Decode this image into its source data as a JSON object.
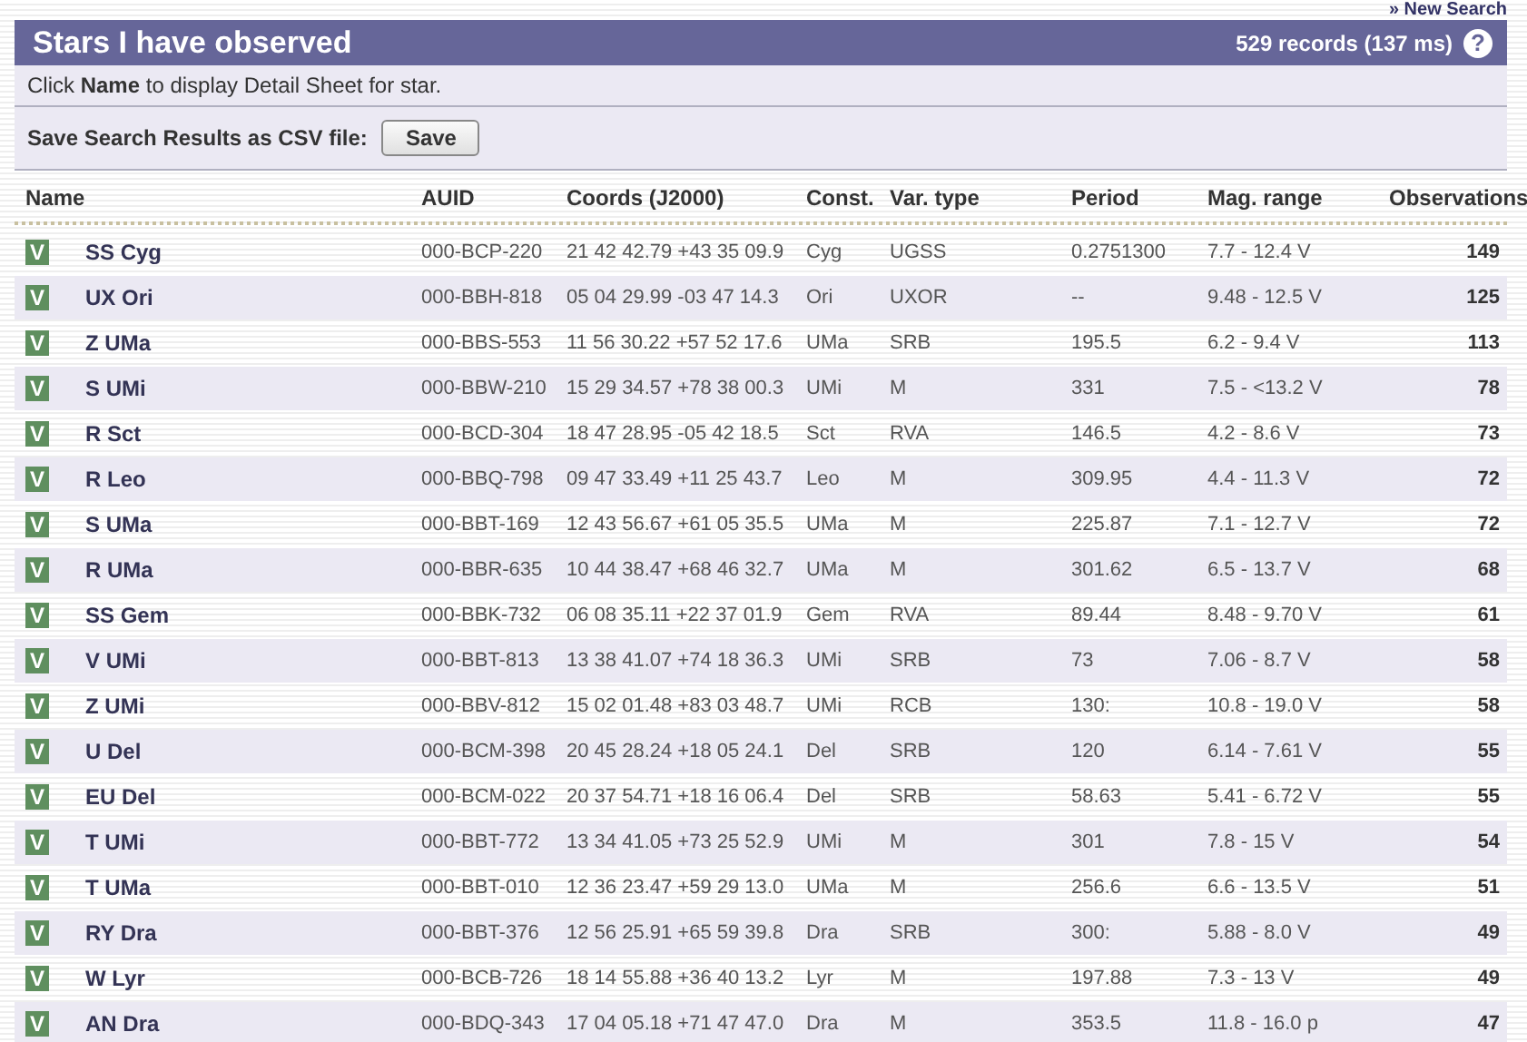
{
  "top_link": "» New Search",
  "header": {
    "title": "Stars I have observed",
    "records": "529 records (137 ms)",
    "help": "?"
  },
  "hint": {
    "before": "Click ",
    "bold": "Name",
    "after": " to display Detail Sheet for star."
  },
  "save": {
    "label": "Save Search Results as CSV file:",
    "button": "Save"
  },
  "table": {
    "columns": [
      "Name",
      "AUID",
      "Coords (J2000)",
      "Const.",
      "Var. type",
      "Period",
      "Mag. range",
      "Observations"
    ],
    "rows": [
      {
        "badge": "V",
        "name": "SS Cyg",
        "auid": "000-BCP-220",
        "coords": "21 42 42.79 +43 35 09.9",
        "const": "Cyg",
        "type": "UGSS",
        "period": "0.2751300",
        "mag": "7.7 - 12.4 V",
        "obs": "149"
      },
      {
        "badge": "V",
        "name": "UX Ori",
        "auid": "000-BBH-818",
        "coords": "05 04 29.99 -03 47 14.3",
        "const": "Ori",
        "type": "UXOR",
        "period": "--",
        "mag": "9.48 - 12.5 V",
        "obs": "125"
      },
      {
        "badge": "V",
        "name": "Z UMa",
        "auid": "000-BBS-553",
        "coords": "11 56 30.22 +57 52 17.6",
        "const": "UMa",
        "type": "SRB",
        "period": "195.5",
        "mag": "6.2 - 9.4 V",
        "obs": "113"
      },
      {
        "badge": "V",
        "name": "S UMi",
        "auid": "000-BBW-210",
        "coords": "15 29 34.57 +78 38 00.3",
        "const": "UMi",
        "type": "M",
        "period": "331",
        "mag": "7.5 - <13.2 V",
        "obs": "78"
      },
      {
        "badge": "V",
        "name": "R Sct",
        "auid": "000-BCD-304",
        "coords": "18 47 28.95 -05 42 18.5",
        "const": "Sct",
        "type": "RVA",
        "period": "146.5",
        "mag": "4.2 - 8.6 V",
        "obs": "73"
      },
      {
        "badge": "V",
        "name": "R Leo",
        "auid": "000-BBQ-798",
        "coords": "09 47 33.49 +11 25 43.7",
        "const": "Leo",
        "type": "M",
        "period": "309.95",
        "mag": "4.4 - 11.3 V",
        "obs": "72"
      },
      {
        "badge": "V",
        "name": "S UMa",
        "auid": "000-BBT-169",
        "coords": "12 43 56.67 +61 05 35.5",
        "const": "UMa",
        "type": "M",
        "period": "225.87",
        "mag": "7.1 - 12.7 V",
        "obs": "72"
      },
      {
        "badge": "V",
        "name": "R UMa",
        "auid": "000-BBR-635",
        "coords": "10 44 38.47 +68 46 32.7",
        "const": "UMa",
        "type": "M",
        "period": "301.62",
        "mag": "6.5 - 13.7 V",
        "obs": "68"
      },
      {
        "badge": "V",
        "name": "SS Gem",
        "auid": "000-BBK-732",
        "coords": "06 08 35.11 +22 37 01.9",
        "const": "Gem",
        "type": "RVA",
        "period": "89.44",
        "mag": "8.48 - 9.70 V",
        "obs": "61"
      },
      {
        "badge": "V",
        "name": "V UMi",
        "auid": "000-BBT-813",
        "coords": "13 38 41.07 +74 18 36.3",
        "const": "UMi",
        "type": "SRB",
        "period": "73",
        "mag": "7.06 - 8.7 V",
        "obs": "58"
      },
      {
        "badge": "V",
        "name": "Z UMi",
        "auid": "000-BBV-812",
        "coords": "15 02 01.48 +83 03 48.7",
        "const": "UMi",
        "type": "RCB",
        "period": "130:",
        "mag": "10.8 - 19.0 V",
        "obs": "58"
      },
      {
        "badge": "V",
        "name": "U Del",
        "auid": "000-BCM-398",
        "coords": "20 45 28.24 +18 05 24.1",
        "const": "Del",
        "type": "SRB",
        "period": "120",
        "mag": "6.14 - 7.61 V",
        "obs": "55"
      },
      {
        "badge": "V",
        "name": "EU Del",
        "auid": "000-BCM-022",
        "coords": "20 37 54.71 +18 16 06.4",
        "const": "Del",
        "type": "SRB",
        "period": "58.63",
        "mag": "5.41 - 6.72 V",
        "obs": "55"
      },
      {
        "badge": "V",
        "name": "T UMi",
        "auid": "000-BBT-772",
        "coords": "13 34 41.05 +73 25 52.9",
        "const": "UMi",
        "type": "M",
        "period": "301",
        "mag": "7.8 - 15 V",
        "obs": "54"
      },
      {
        "badge": "V",
        "name": "T UMa",
        "auid": "000-BBT-010",
        "coords": "12 36 23.47 +59 29 13.0",
        "const": "UMa",
        "type": "M",
        "period": "256.6",
        "mag": "6.6 - 13.5 V",
        "obs": "51"
      },
      {
        "badge": "V",
        "name": "RY Dra",
        "auid": "000-BBT-376",
        "coords": "12 56 25.91 +65 59 39.8",
        "const": "Dra",
        "type": "SRB",
        "period": "300:",
        "mag": "5.88 - 8.0 V",
        "obs": "49"
      },
      {
        "badge": "V",
        "name": "W Lyr",
        "auid": "000-BCB-726",
        "coords": "18 14 55.88 +36 40 13.2",
        "const": "Lyr",
        "type": "M",
        "period": "197.88",
        "mag": "7.3 - 13 V",
        "obs": "49"
      },
      {
        "badge": "V",
        "name": "AN Dra",
        "auid": "000-BDQ-343",
        "coords": "17 04 05.18 +71 47 47.0",
        "const": "Dra",
        "type": "M",
        "period": "353.5",
        "mag": "11.8 - 16.0 p",
        "obs": "47"
      }
    ]
  }
}
